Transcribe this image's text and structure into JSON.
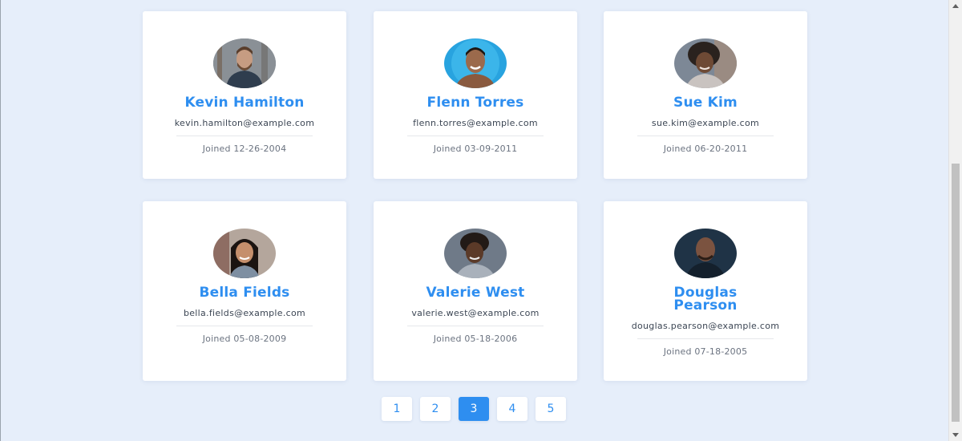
{
  "users": [
    {
      "name": "Kevin Hamilton",
      "email": "kevin.hamilton@example.com",
      "joined": "Joined 12-26-2004",
      "avatar": "man-beard-photo"
    },
    {
      "name": "Flenn Torres",
      "email": "flenn.torres@example.com",
      "joined": "Joined 03-09-2011",
      "avatar": "man-smiling-photo"
    },
    {
      "name": "Sue Kim",
      "email": "sue.kim@example.com",
      "joined": "Joined 06-20-2011",
      "avatar": "woman-curly-hair-photo"
    },
    {
      "name": "Bella Fields",
      "email": "bella.fields@example.com",
      "joined": "Joined 05-08-2009",
      "avatar": "woman-long-hair-photo"
    },
    {
      "name": "Valerie West",
      "email": "valerie.west@example.com",
      "joined": "Joined 05-18-2006",
      "avatar": "woman-short-hair-photo"
    },
    {
      "name": "Douglas Pearson",
      "email": "douglas.pearson@example.com",
      "joined": "Joined 07-18-2005",
      "avatar": "man-bald-photo"
    }
  ],
  "pagination": {
    "pages": [
      "1",
      "2",
      "3",
      "4",
      "5"
    ],
    "current": "3"
  },
  "colors": {
    "background": "#e6eefa",
    "accent": "#2e8ef0",
    "card": "#ffffff"
  }
}
